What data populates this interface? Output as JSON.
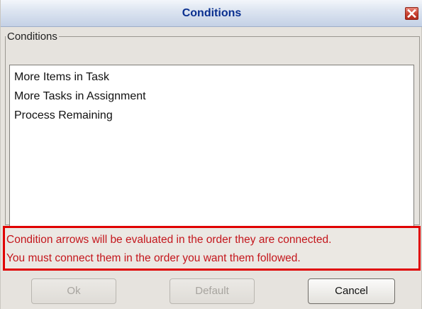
{
  "window": {
    "title": "Conditions",
    "close_icon": "close-icon"
  },
  "conditions_group": {
    "legend": "Conditions",
    "items": [
      "More Items in Task",
      "More Tasks in Assignment",
      "Process Remaining"
    ]
  },
  "warning": {
    "line1": "Condition arrows will be evaluated in the order they are connected.",
    "line2": "You must connect them in the order you want them followed.",
    "color": "#c4161c",
    "border_color": "#e00000"
  },
  "buttons": {
    "ok_label": "Ok",
    "ok_enabled": false,
    "default_label": "Default",
    "default_enabled": false,
    "cancel_label": "Cancel",
    "cancel_enabled": true
  }
}
